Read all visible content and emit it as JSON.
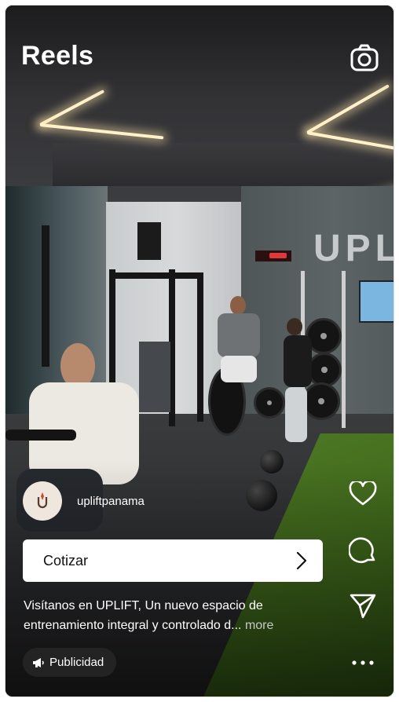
{
  "header": {
    "title": "Reels",
    "camera_icon": "camera-icon"
  },
  "background": {
    "wall_sign_text": "UPLIFT"
  },
  "post": {
    "account_name": "upliftpanama",
    "avatar_icon": "uplift-logo-icon",
    "cta_label": "Cotizar",
    "cta_icon": "chevron-right-icon",
    "caption_text": "Visítanos en UPLIFT, Un nuevo espacio de entrenamiento integral y controlado d...",
    "more_label": "more",
    "sponsored_label": "Publicidad",
    "sponsored_icon": "megaphone-icon"
  },
  "actions": {
    "like_icon": "heart-icon",
    "comment_icon": "comment-icon",
    "share_icon": "send-icon",
    "more_icon": "more-options-icon"
  },
  "colors": {
    "overlay_text": "#ffffff",
    "cta_background": "#ffffff",
    "badge_background": "#282828",
    "avatar_background": "#efe6dd"
  }
}
